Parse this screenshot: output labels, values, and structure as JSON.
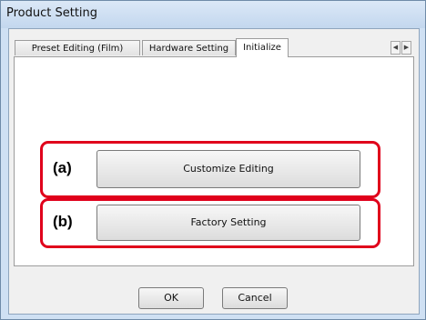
{
  "window": {
    "title": "Product Setting"
  },
  "tabs": {
    "items": [
      {
        "label": "Preset Editing (Film)"
      },
      {
        "label": "Hardware Setting"
      },
      {
        "label": "Initialize"
      }
    ],
    "active_index": 2,
    "scroll_left": "◀",
    "scroll_right": "▶"
  },
  "panel": {
    "options": [
      {
        "marker": "(a)",
        "button_label": "Customize Editing"
      },
      {
        "marker": "(b)",
        "button_label": "Factory Setting"
      }
    ],
    "highlight_color": "#e0001b"
  },
  "footer": {
    "ok_label": "OK",
    "cancel_label": "Cancel"
  }
}
